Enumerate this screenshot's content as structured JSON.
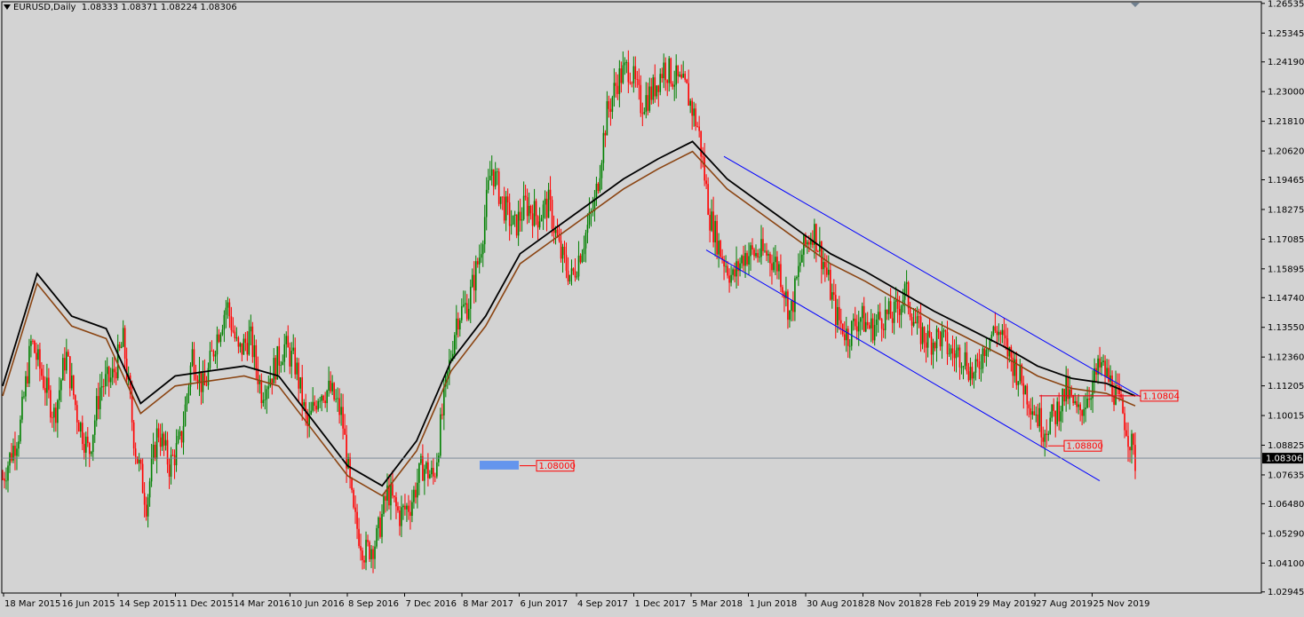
{
  "header": {
    "symbol_label": "EURUSD,Daily",
    "ohlc": "1.08333 1.08371 1.08224 1.08306"
  },
  "chart_data": {
    "type": "candlestick",
    "symbol": "EURUSD",
    "timeframe": "Daily",
    "ylim": [
      1.029,
      1.266
    ],
    "y_ticks": [
      "1.26535",
      "1.25345",
      "1.24190",
      "1.23000",
      "1.21810",
      "1.20620",
      "1.19465",
      "1.18275",
      "1.17085",
      "1.15895",
      "1.14740",
      "1.13550",
      "1.12360",
      "1.11205",
      "1.10015",
      "1.08825",
      "1.07635",
      "1.06480",
      "1.05290",
      "1.04100",
      "1.02945"
    ],
    "x_labels": [
      "18 Mar 2015",
      "16 Jun 2015",
      "14 Sep 2015",
      "11 Dec 2015",
      "14 Mar 2016",
      "10 Jun 2016",
      "8 Sep 2016",
      "7 Dec 2016",
      "8 Mar 2017",
      "6 Jun 2017",
      "4 Sep 2017",
      "1 Dec 2017",
      "5 Mar 2018",
      "1 Jun 2018",
      "30 Aug 2018",
      "28 Nov 2018",
      "28 Feb 2019",
      "29 May 2019",
      "27 Aug 2019",
      "25 Nov 2019"
    ],
    "price_path": [
      [
        0,
        1.075
      ],
      [
        3,
        1.095
      ],
      [
        5,
        1.13
      ],
      [
        7,
        1.115
      ],
      [
        9,
        1.1
      ],
      [
        11,
        1.125
      ],
      [
        13,
        1.1
      ],
      [
        15,
        1.085
      ],
      [
        17,
        1.112
      ],
      [
        19,
        1.115
      ],
      [
        21,
        1.13
      ],
      [
        23,
        1.088
      ],
      [
        25,
        1.065
      ],
      [
        27,
        1.095
      ],
      [
        29,
        1.08
      ],
      [
        31,
        1.09
      ],
      [
        33,
        1.125
      ],
      [
        35,
        1.11
      ],
      [
        37,
        1.13
      ],
      [
        39,
        1.145
      ],
      [
        41,
        1.125
      ],
      [
        43,
        1.132
      ],
      [
        45,
        1.11
      ],
      [
        47,
        1.118
      ],
      [
        49,
        1.128
      ],
      [
        51,
        1.12
      ],
      [
        53,
        1.095
      ],
      [
        55,
        1.11
      ],
      [
        57,
        1.11
      ],
      [
        59,
        1.1
      ],
      [
        61,
        1.06
      ],
      [
        63,
        1.045
      ],
      [
        65,
        1.05
      ],
      [
        67,
        1.07
      ],
      [
        69,
        1.06
      ],
      [
        71,
        1.065
      ],
      [
        73,
        1.08
      ],
      [
        75,
        1.075
      ],
      [
        77,
        1.11
      ],
      [
        79,
        1.14
      ],
      [
        81,
        1.145
      ],
      [
        83,
        1.165
      ],
      [
        85,
        1.2
      ],
      [
        87,
        1.185
      ],
      [
        89,
        1.175
      ],
      [
        91,
        1.185
      ],
      [
        93,
        1.18
      ],
      [
        95,
        1.185
      ],
      [
        97,
        1.165
      ],
      [
        99,
        1.155
      ],
      [
        101,
        1.17
      ],
      [
        103,
        1.185
      ],
      [
        105,
        1.22
      ],
      [
        107,
        1.235
      ],
      [
        109,
        1.24
      ],
      [
        111,
        1.225
      ],
      [
        113,
        1.23
      ],
      [
        115,
        1.24
      ],
      [
        117,
        1.235
      ],
      [
        119,
        1.23
      ],
      [
        121,
        1.215
      ],
      [
        123,
        1.18
      ],
      [
        125,
        1.165
      ],
      [
        127,
        1.155
      ],
      [
        129,
        1.165
      ],
      [
        131,
        1.165
      ],
      [
        133,
        1.165
      ],
      [
        135,
        1.16
      ],
      [
        137,
        1.14
      ],
      [
        139,
        1.165
      ],
      [
        141,
        1.175
      ],
      [
        143,
        1.16
      ],
      [
        145,
        1.14
      ],
      [
        147,
        1.132
      ],
      [
        149,
        1.14
      ],
      [
        151,
        1.135
      ],
      [
        153,
        1.14
      ],
      [
        155,
        1.14
      ],
      [
        157,
        1.15
      ],
      [
        159,
        1.135
      ],
      [
        161,
        1.13
      ],
      [
        163,
        1.132
      ],
      [
        165,
        1.125
      ],
      [
        167,
        1.125
      ],
      [
        169,
        1.115
      ],
      [
        171,
        1.13
      ],
      [
        173,
        1.135
      ],
      [
        175,
        1.125
      ],
      [
        177,
        1.115
      ],
      [
        179,
        1.105
      ],
      [
        181,
        1.095
      ],
      [
        183,
        1.1
      ],
      [
        185,
        1.11
      ],
      [
        187,
        1.1
      ],
      [
        189,
        1.11
      ],
      [
        191,
        1.12
      ],
      [
        193,
        1.112
      ],
      [
        195,
        1.1
      ],
      [
        197,
        1.082
      ]
    ],
    "series": [
      {
        "name": "",
        "color": "#000000"
      },
      {
        "name": "",
        "color": "#8b4513"
      }
    ],
    "ma_black": [
      [
        0,
        1.112
      ],
      [
        6,
        1.157
      ],
      [
        12,
        1.14
      ],
      [
        18,
        1.135
      ],
      [
        24,
        1.105
      ],
      [
        30,
        1.116
      ],
      [
        36,
        1.118
      ],
      [
        42,
        1.12
      ],
      [
        48,
        1.116
      ],
      [
        54,
        1.098
      ],
      [
        60,
        1.08
      ],
      [
        66,
        1.072
      ],
      [
        72,
        1.09
      ],
      [
        78,
        1.122
      ],
      [
        84,
        1.14
      ],
      [
        90,
        1.165
      ],
      [
        96,
        1.175
      ],
      [
        102,
        1.185
      ],
      [
        108,
        1.195
      ],
      [
        114,
        1.203
      ],
      [
        120,
        1.21
      ],
      [
        126,
        1.195
      ],
      [
        132,
        1.185
      ],
      [
        138,
        1.175
      ],
      [
        144,
        1.165
      ],
      [
        150,
        1.158
      ],
      [
        156,
        1.15
      ],
      [
        162,
        1.142
      ],
      [
        168,
        1.135
      ],
      [
        174,
        1.128
      ],
      [
        180,
        1.12
      ],
      [
        186,
        1.115
      ],
      [
        192,
        1.113
      ],
      [
        197,
        1.108
      ]
    ],
    "levels": [
      {
        "label": "1.08000",
        "value": 1.08,
        "color": "#ff0000"
      },
      {
        "label": "1.08800",
        "value": 1.088,
        "color": "#ff0000"
      },
      {
        "label": "1.10804",
        "value": 1.10804,
        "color": "#ff0000"
      }
    ],
    "current_price": {
      "label": "1.08306",
      "value": 1.08306
    }
  }
}
